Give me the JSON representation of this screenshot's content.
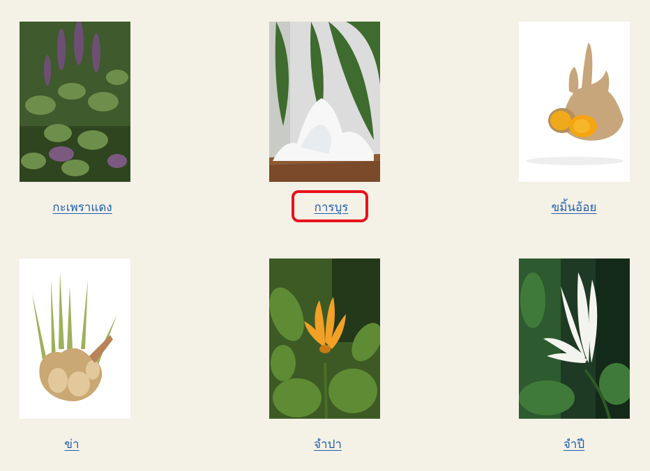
{
  "plants": [
    {
      "id": "holy-basil",
      "label": "กะเพราแดง",
      "image_subject": "red holy basil plant"
    },
    {
      "id": "camphor",
      "label": "การบูร",
      "image_subject": "camphor crystals with leaves"
    },
    {
      "id": "wild-turmeric",
      "label": "ขมิ้นอ้อย",
      "image_subject": "wild turmeric rhizome"
    },
    {
      "id": "galangal",
      "label": "ข่า",
      "image_subject": "galangal rhizome"
    },
    {
      "id": "champak",
      "label": "จำปา",
      "image_subject": "orange champak flower"
    },
    {
      "id": "white-champak",
      "label": "จำปี",
      "image_subject": "white champak flower"
    }
  ],
  "highlight": {
    "target": "camphor",
    "color": "#e8121a"
  },
  "colors": {
    "background": "#f4f1e6",
    "link": "#1e5fae"
  }
}
